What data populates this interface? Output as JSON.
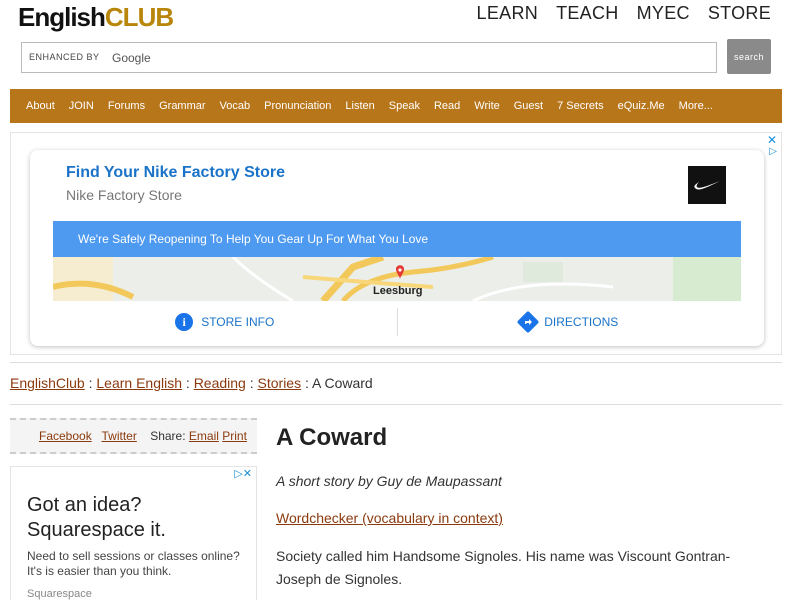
{
  "header": {
    "logo_english": "English",
    "logo_club": "CLUB",
    "nav": [
      "LEARN",
      "TEACH",
      "MYEC",
      "STORE"
    ]
  },
  "search": {
    "enhanced_label": "ENHANCED BY",
    "google_label": "Google",
    "button_label": "search"
  },
  "menu": [
    "About",
    "JOIN",
    "Forums",
    "Grammar",
    "Vocab",
    "Pronunciation",
    "Listen",
    "Speak",
    "Read",
    "Write",
    "Guest",
    "7 Secrets",
    "eQuiz.Me",
    "More..."
  ],
  "ad": {
    "title": "Find Your Nike Factory Store",
    "subtitle": "Nike Factory Store",
    "banner": "We're Safely Reopening To Help You Gear Up For What You Love",
    "map_label": "Leesburg",
    "store_info": "STORE INFO",
    "directions": "DIRECTIONS"
  },
  "breadcrumb": {
    "items": [
      "EnglishClub",
      "Learn English",
      "Reading",
      "Stories"
    ],
    "current": "A Coward",
    "separator": " : "
  },
  "share": {
    "facebook": "Facebook",
    "twitter": "Twitter",
    "share_label": "Share:",
    "email": "Email",
    "print": "Print"
  },
  "side_ad": {
    "headline_1": "Got an idea?",
    "headline_2": "Squarespace it.",
    "body": "Need to sell sessions or classes online? It's is easier than you think.",
    "brand": "Squarespace"
  },
  "article": {
    "title": "A Coward",
    "byline": "A short story by Guy de Maupassant",
    "wordchecker": "Wordchecker (vocabulary in context)",
    "paragraph_1": "Society called him Handsome Signoles. His name was Viscount Gontran-Joseph de Signoles."
  },
  "colors": {
    "menu_bg": "#b8761b",
    "link": "#8b3a0e",
    "ad_blue": "#1a73c8",
    "banner_blue": "#4e9af0"
  }
}
